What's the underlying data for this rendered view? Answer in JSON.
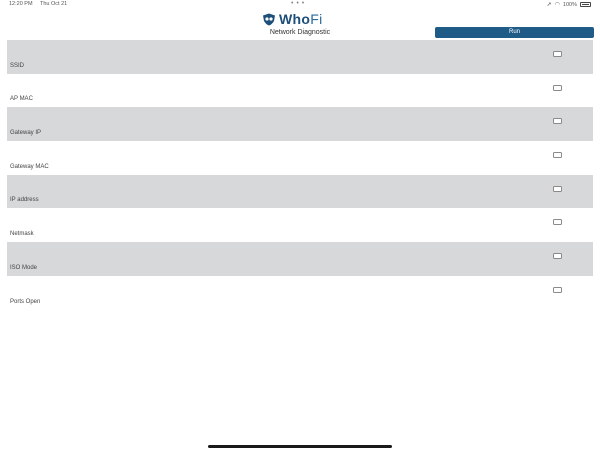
{
  "status_bar": {
    "time": "12:20 PM",
    "date": "Thu Oct 21",
    "dots": "• • •",
    "battery_percent": "100%"
  },
  "header": {
    "logo_bold": "Who",
    "logo_light": "Fi",
    "title": "Network Diagnostic",
    "run_label": "Run"
  },
  "rows": [
    {
      "label": "SSID"
    },
    {
      "label": "AP MAC"
    },
    {
      "label": "Gateway IP"
    },
    {
      "label": "Gateway MAC"
    },
    {
      "label": "IP address"
    },
    {
      "label": "Netmask"
    },
    {
      "label": "ISO Mode"
    },
    {
      "label": "Ports Open"
    }
  ],
  "colors": {
    "brand": "#1d4f7a",
    "button": "#1e5b86",
    "row_shade": "#d7d8d9"
  }
}
